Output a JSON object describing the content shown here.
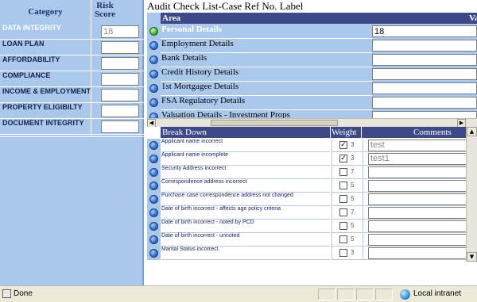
{
  "left_panel": {
    "category_header": "Category",
    "risk_header": "Risk Score",
    "rows": [
      {
        "label": "DATA INTEGRITY",
        "score": "18"
      },
      {
        "label": "LOAN PLAN",
        "score": ""
      },
      {
        "label": "AFFORDABILITY",
        "score": ""
      },
      {
        "label": "COMPLIANCE",
        "score": ""
      },
      {
        "label": "INCOME & EMPLOYMENT",
        "score": ""
      },
      {
        "label": "PROPERTY ELIGIBILTY",
        "score": ""
      },
      {
        "label": "DOCUMENT INTEGRITY",
        "score": ""
      }
    ]
  },
  "title": "Audit Check List-Case Ref No.  Label",
  "area_grid": {
    "header_area": "Area",
    "header_value": "Value",
    "rows": [
      {
        "label": "Personal Details",
        "value": "18",
        "selected": true
      },
      {
        "label": "Employment Details",
        "value": "",
        "selected": false
      },
      {
        "label": "Bank Details",
        "value": "",
        "selected": false
      },
      {
        "label": "Credit History Details",
        "value": "",
        "selected": false
      },
      {
        "label": "1st Mortgagee Details",
        "value": "",
        "selected": false
      },
      {
        "label": "FSA Regulatory Details",
        "value": "",
        "selected": false
      },
      {
        "label": "Valuation Details - Investment Props",
        "value": "",
        "selected": false
      }
    ]
  },
  "breakdown_grid": {
    "header_breakdown": "Break Down",
    "header_weight": "Weight",
    "header_comments": "Comments",
    "rows": [
      {
        "label": "Applicant name incorrect",
        "checked": true,
        "weight": "3",
        "comment": "test"
      },
      {
        "label": "Applicant name incomplete",
        "checked": true,
        "weight": "3",
        "comment": "test1"
      },
      {
        "label": "Security Address incorrect",
        "checked": false,
        "weight": "7",
        "comment": ""
      },
      {
        "label": "Correspondence address incorrect",
        "checked": false,
        "weight": "5",
        "comment": ""
      },
      {
        "label": "Purchase case correspondence address not changed",
        "checked": false,
        "weight": "5",
        "comment": ""
      },
      {
        "label": "Date of birth incorrect - affects age policy criteria",
        "checked": false,
        "weight": "7",
        "comment": ""
      },
      {
        "label": "Date of birth incorrect - noted by PCD",
        "checked": false,
        "weight": "5",
        "comment": ""
      },
      {
        "label": "Date of birth incorrect - unnoted",
        "checked": false,
        "weight": "5",
        "comment": ""
      },
      {
        "label": "Marital Status incorrect",
        "checked": false,
        "weight": "3",
        "comment": ""
      }
    ]
  },
  "status_bar": {
    "status_text": "Done",
    "zone_text": "Local intranet"
  },
  "colors": {
    "panel_blue": "#a9c8ec",
    "header_navy": "#3d4a87",
    "selected_dot": "#3cb034",
    "row_dot": "#2f6fd0"
  }
}
